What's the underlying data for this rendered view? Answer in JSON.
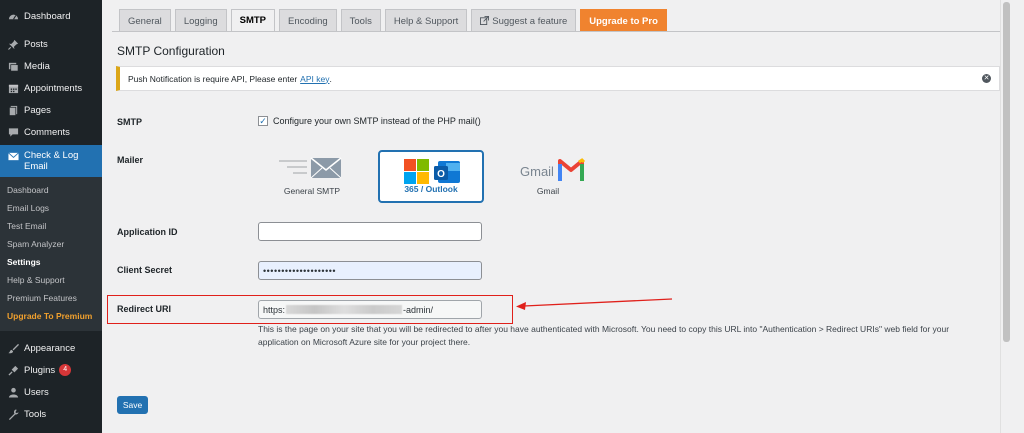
{
  "sidebar": {
    "top_items": [
      {
        "label": "Dashboard",
        "icon": "dashboard-icon"
      },
      {
        "label": "Posts",
        "icon": "pin-icon"
      },
      {
        "label": "Media",
        "icon": "media-icon"
      },
      {
        "label": "Appointments",
        "icon": "calendar-icon"
      },
      {
        "label": "Pages",
        "icon": "pages-icon"
      },
      {
        "label": "Comments",
        "icon": "comment-icon"
      }
    ],
    "active_item": {
      "label": "Check & Log Email",
      "icon": "email-icon"
    },
    "submenu": [
      {
        "label": "Dashboard"
      },
      {
        "label": "Email Logs"
      },
      {
        "label": "Test Email"
      },
      {
        "label": "Spam Analyzer"
      },
      {
        "label": "Settings"
      },
      {
        "label": "Help & Support"
      },
      {
        "label": "Premium Features"
      },
      {
        "label": "Upgrade To Premium"
      }
    ],
    "bottom_items": [
      {
        "label": "Appearance",
        "icon": "brush-icon"
      },
      {
        "label": "Plugins",
        "icon": "plugin-icon",
        "badge": "4"
      },
      {
        "label": "Users",
        "icon": "users-icon"
      },
      {
        "label": "Tools",
        "icon": "wrench-icon"
      }
    ]
  },
  "tabs": [
    {
      "label": "General"
    },
    {
      "label": "Logging"
    },
    {
      "label": "SMTP"
    },
    {
      "label": "Encoding"
    },
    {
      "label": "Tools"
    },
    {
      "label": "Help & Support"
    },
    {
      "label": "Suggest a feature"
    },
    {
      "label": "Upgrade to Pro"
    }
  ],
  "page_title": "SMTP Configuration",
  "notice": {
    "text": "Push Notification is require API, Please enter",
    "link": "API key",
    "suffix": "."
  },
  "form": {
    "smtp_label": "SMTP",
    "smtp_checkbox_label": "Configure your own SMTP instead of the PHP mail()",
    "mailer_label": "Mailer",
    "mailers": [
      {
        "label": "General SMTP"
      },
      {
        "label": "365 / Outlook"
      },
      {
        "label": "Gmail"
      }
    ],
    "gmail_wordmark": "Gmail",
    "outlook_letter": "O",
    "app_id_label": "Application ID",
    "app_id_value": "",
    "client_secret_label": "Client Secret",
    "client_secret_value": "••••••••••••••••••••",
    "redirect_uri_label": "Redirect URI",
    "redirect_uri_prefix": "https:",
    "redirect_uri_suffix": "-admin/",
    "redirect_help": "This is the page on your site that you will be redirected to after you have authenticated with Microsoft. You need to copy this URL into \"Authentication > Redirect URIs\" web field for your application on Microsoft Azure site for your project there.",
    "save_label": "Save"
  },
  "colors": {
    "wp_blue": "#2271b1",
    "sidebar_bg": "#1d2327",
    "pro_orange": "#f0832f",
    "highlight_red": "#e0201b"
  }
}
